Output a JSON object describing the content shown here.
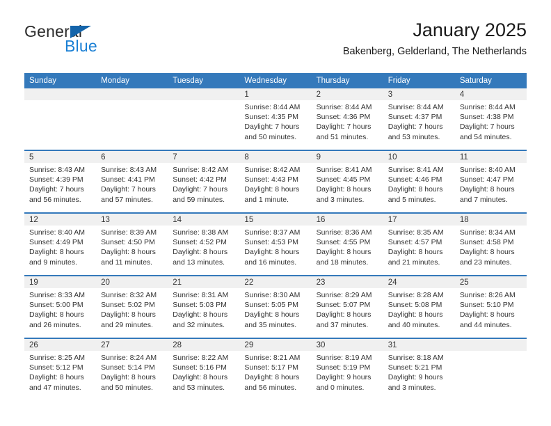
{
  "brand": {
    "name_top": "General",
    "name_bottom": "Blue",
    "triangle_color": "#1464aa",
    "blue_color": "#1a7fd4"
  },
  "header": {
    "title": "January 2025",
    "subtitle": "Bakenberg, Gelderland, The Netherlands"
  },
  "calendar": {
    "accent_color": "#3479bb",
    "daynum_band_color": "#f0f0f0",
    "weekday_headers": [
      "Sunday",
      "Monday",
      "Tuesday",
      "Wednesday",
      "Thursday",
      "Friday",
      "Saturday"
    ],
    "labels": {
      "sunrise": "Sunrise:",
      "sunset": "Sunset:",
      "daylight": "Daylight:"
    },
    "weeks": [
      [
        {
          "day": "",
          "empty": true
        },
        {
          "day": "",
          "empty": true
        },
        {
          "day": "",
          "empty": true
        },
        {
          "day": "1",
          "sunrise": "Sunrise: 8:44 AM",
          "sunset": "Sunset: 4:35 PM",
          "daylight_1": "Daylight: 7 hours",
          "daylight_2": "and 50 minutes."
        },
        {
          "day": "2",
          "sunrise": "Sunrise: 8:44 AM",
          "sunset": "Sunset: 4:36 PM",
          "daylight_1": "Daylight: 7 hours",
          "daylight_2": "and 51 minutes."
        },
        {
          "day": "3",
          "sunrise": "Sunrise: 8:44 AM",
          "sunset": "Sunset: 4:37 PM",
          "daylight_1": "Daylight: 7 hours",
          "daylight_2": "and 53 minutes."
        },
        {
          "day": "4",
          "sunrise": "Sunrise: 8:44 AM",
          "sunset": "Sunset: 4:38 PM",
          "daylight_1": "Daylight: 7 hours",
          "daylight_2": "and 54 minutes."
        }
      ],
      [
        {
          "day": "5",
          "sunrise": "Sunrise: 8:43 AM",
          "sunset": "Sunset: 4:39 PM",
          "daylight_1": "Daylight: 7 hours",
          "daylight_2": "and 56 minutes."
        },
        {
          "day": "6",
          "sunrise": "Sunrise: 8:43 AM",
          "sunset": "Sunset: 4:41 PM",
          "daylight_1": "Daylight: 7 hours",
          "daylight_2": "and 57 minutes."
        },
        {
          "day": "7",
          "sunrise": "Sunrise: 8:42 AM",
          "sunset": "Sunset: 4:42 PM",
          "daylight_1": "Daylight: 7 hours",
          "daylight_2": "and 59 minutes."
        },
        {
          "day": "8",
          "sunrise": "Sunrise: 8:42 AM",
          "sunset": "Sunset: 4:43 PM",
          "daylight_1": "Daylight: 8 hours",
          "daylight_2": "and 1 minute."
        },
        {
          "day": "9",
          "sunrise": "Sunrise: 8:41 AM",
          "sunset": "Sunset: 4:45 PM",
          "daylight_1": "Daylight: 8 hours",
          "daylight_2": "and 3 minutes."
        },
        {
          "day": "10",
          "sunrise": "Sunrise: 8:41 AM",
          "sunset": "Sunset: 4:46 PM",
          "daylight_1": "Daylight: 8 hours",
          "daylight_2": "and 5 minutes."
        },
        {
          "day": "11",
          "sunrise": "Sunrise: 8:40 AM",
          "sunset": "Sunset: 4:47 PM",
          "daylight_1": "Daylight: 8 hours",
          "daylight_2": "and 7 minutes."
        }
      ],
      [
        {
          "day": "12",
          "sunrise": "Sunrise: 8:40 AM",
          "sunset": "Sunset: 4:49 PM",
          "daylight_1": "Daylight: 8 hours",
          "daylight_2": "and 9 minutes."
        },
        {
          "day": "13",
          "sunrise": "Sunrise: 8:39 AM",
          "sunset": "Sunset: 4:50 PM",
          "daylight_1": "Daylight: 8 hours",
          "daylight_2": "and 11 minutes."
        },
        {
          "day": "14",
          "sunrise": "Sunrise: 8:38 AM",
          "sunset": "Sunset: 4:52 PM",
          "daylight_1": "Daylight: 8 hours",
          "daylight_2": "and 13 minutes."
        },
        {
          "day": "15",
          "sunrise": "Sunrise: 8:37 AM",
          "sunset": "Sunset: 4:53 PM",
          "daylight_1": "Daylight: 8 hours",
          "daylight_2": "and 16 minutes."
        },
        {
          "day": "16",
          "sunrise": "Sunrise: 8:36 AM",
          "sunset": "Sunset: 4:55 PM",
          "daylight_1": "Daylight: 8 hours",
          "daylight_2": "and 18 minutes."
        },
        {
          "day": "17",
          "sunrise": "Sunrise: 8:35 AM",
          "sunset": "Sunset: 4:57 PM",
          "daylight_1": "Daylight: 8 hours",
          "daylight_2": "and 21 minutes."
        },
        {
          "day": "18",
          "sunrise": "Sunrise: 8:34 AM",
          "sunset": "Sunset: 4:58 PM",
          "daylight_1": "Daylight: 8 hours",
          "daylight_2": "and 23 minutes."
        }
      ],
      [
        {
          "day": "19",
          "sunrise": "Sunrise: 8:33 AM",
          "sunset": "Sunset: 5:00 PM",
          "daylight_1": "Daylight: 8 hours",
          "daylight_2": "and 26 minutes."
        },
        {
          "day": "20",
          "sunrise": "Sunrise: 8:32 AM",
          "sunset": "Sunset: 5:02 PM",
          "daylight_1": "Daylight: 8 hours",
          "daylight_2": "and 29 minutes."
        },
        {
          "day": "21",
          "sunrise": "Sunrise: 8:31 AM",
          "sunset": "Sunset: 5:03 PM",
          "daylight_1": "Daylight: 8 hours",
          "daylight_2": "and 32 minutes."
        },
        {
          "day": "22",
          "sunrise": "Sunrise: 8:30 AM",
          "sunset": "Sunset: 5:05 PM",
          "daylight_1": "Daylight: 8 hours",
          "daylight_2": "and 35 minutes."
        },
        {
          "day": "23",
          "sunrise": "Sunrise: 8:29 AM",
          "sunset": "Sunset: 5:07 PM",
          "daylight_1": "Daylight: 8 hours",
          "daylight_2": "and 37 minutes."
        },
        {
          "day": "24",
          "sunrise": "Sunrise: 8:28 AM",
          "sunset": "Sunset: 5:08 PM",
          "daylight_1": "Daylight: 8 hours",
          "daylight_2": "and 40 minutes."
        },
        {
          "day": "25",
          "sunrise": "Sunrise: 8:26 AM",
          "sunset": "Sunset: 5:10 PM",
          "daylight_1": "Daylight: 8 hours",
          "daylight_2": "and 44 minutes."
        }
      ],
      [
        {
          "day": "26",
          "sunrise": "Sunrise: 8:25 AM",
          "sunset": "Sunset: 5:12 PM",
          "daylight_1": "Daylight: 8 hours",
          "daylight_2": "and 47 minutes."
        },
        {
          "day": "27",
          "sunrise": "Sunrise: 8:24 AM",
          "sunset": "Sunset: 5:14 PM",
          "daylight_1": "Daylight: 8 hours",
          "daylight_2": "and 50 minutes."
        },
        {
          "day": "28",
          "sunrise": "Sunrise: 8:22 AM",
          "sunset": "Sunset: 5:16 PM",
          "daylight_1": "Daylight: 8 hours",
          "daylight_2": "and 53 minutes."
        },
        {
          "day": "29",
          "sunrise": "Sunrise: 8:21 AM",
          "sunset": "Sunset: 5:17 PM",
          "daylight_1": "Daylight: 8 hours",
          "daylight_2": "and 56 minutes."
        },
        {
          "day": "30",
          "sunrise": "Sunrise: 8:19 AM",
          "sunset": "Sunset: 5:19 PM",
          "daylight_1": "Daylight: 9 hours",
          "daylight_2": "and 0 minutes."
        },
        {
          "day": "31",
          "sunrise": "Sunrise: 8:18 AM",
          "sunset": "Sunset: 5:21 PM",
          "daylight_1": "Daylight: 9 hours",
          "daylight_2": "and 3 minutes."
        },
        {
          "day": "",
          "empty": true
        }
      ]
    ]
  }
}
